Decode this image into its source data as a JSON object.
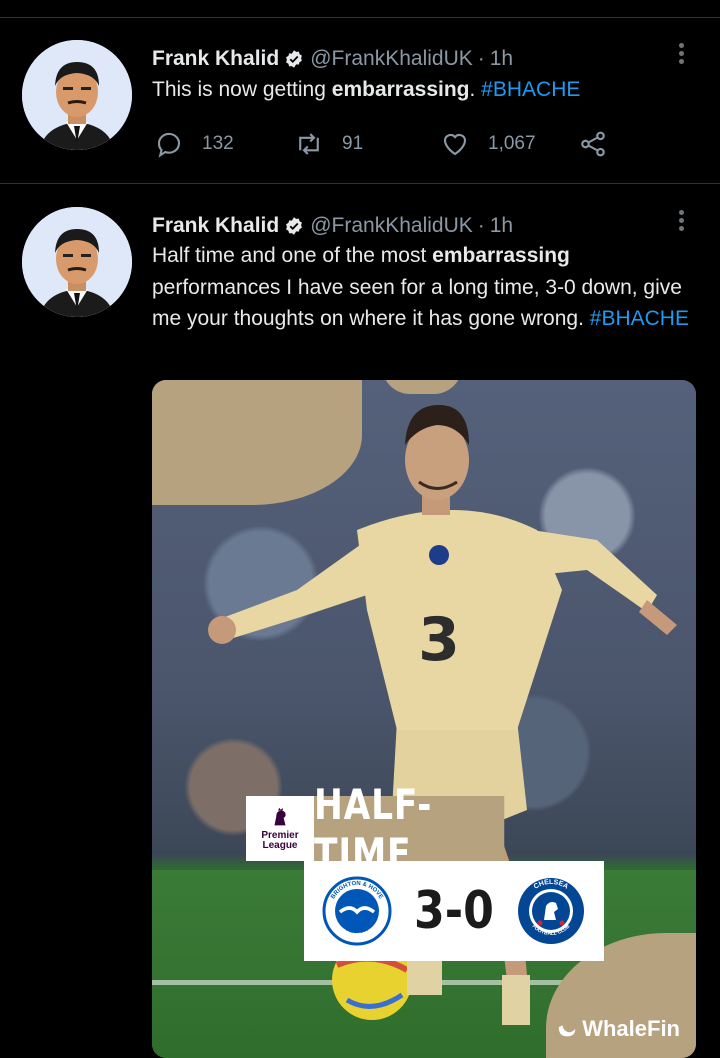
{
  "tweets": [
    {
      "author": {
        "name": "Frank Khalid",
        "handle": "@FrankKhalidUK",
        "time": "1h"
      },
      "text_parts": {
        "pre": "This is now getting ",
        "bold": "embarrassing",
        "post": ". ",
        "hashtag": "#BHACHE"
      },
      "actions": {
        "replies": "132",
        "retweets": "91",
        "likes": "1,067"
      }
    },
    {
      "author": {
        "name": "Frank Khalid",
        "handle": "@FrankKhalidUK",
        "time": "1h"
      },
      "text_parts": {
        "pre": "Half time and one of the most ",
        "bold": "embarrassing",
        "post": " performances I have seen for a long time, 3-0 down, give me your thoughts on where it has gone wrong. ",
        "hashtag": "#BHACHE"
      },
      "media": {
        "league_label_line1": "Premier",
        "league_label_line2": "League",
        "banner": "HALF-TIME",
        "score": "3-0",
        "watermark": "WhaleFin",
        "home_crest_text": "BRIGHTON & HOVE ALBION",
        "away_crest_text": "CHELSEA FOOTBALL CLUB",
        "home_crest_top": "BRIGHTON & HOVE",
        "home_crest_bottom": "ALBION",
        "away_crest_top": "CHELSEA",
        "away_crest_bottom": "FOOTBALL CLUB"
      }
    }
  ],
  "icons": {
    "verified": "verified-badge-icon",
    "more": "more-options-icon",
    "reply": "reply-icon",
    "retweet": "retweet-icon",
    "like": "heart-icon",
    "share": "share-icon"
  },
  "colors": {
    "background": "#000000",
    "text": "#e7e9ea",
    "muted": "#8b98a5",
    "link": "#1d9bf0",
    "divider": "#2f3336",
    "banner_gold": "#b6a27e"
  }
}
